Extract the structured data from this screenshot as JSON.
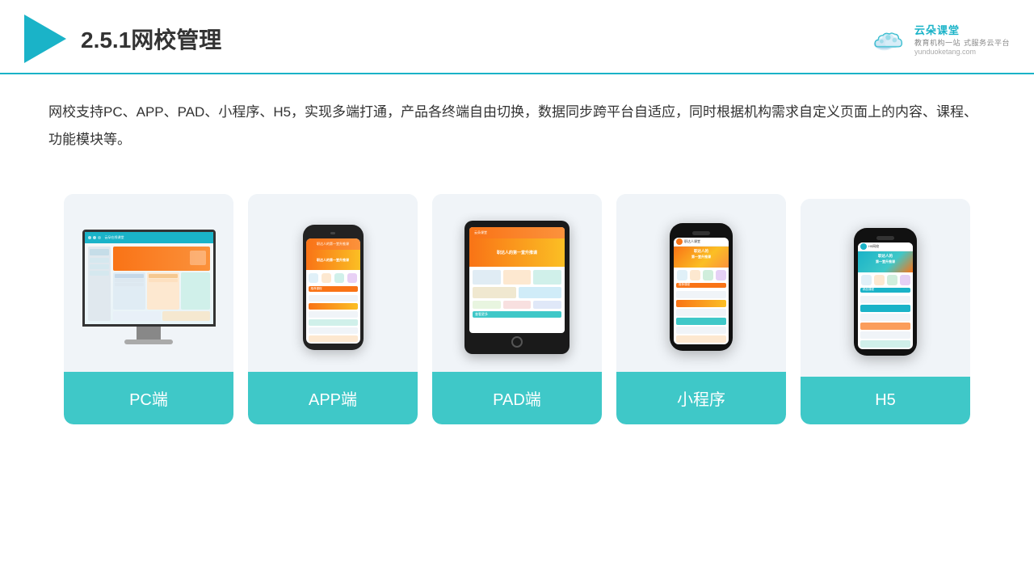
{
  "header": {
    "title": "网校管理",
    "title_prefix": "2.5.1",
    "brand_name": "云朵课堂",
    "brand_url": "yunduoketang.com",
    "brand_tagline": "教育机构一站",
    "brand_tagline2": "式服务云平台"
  },
  "description": {
    "text": "网校支持PC、APP、PAD、小程序、H5，实现多端打通，产品各终端自由切换，数据同步跨平台自适应，同时根据机构需求自定义页面上的内容、课程、功能模块等。"
  },
  "cards": [
    {
      "id": "pc",
      "label": "PC端"
    },
    {
      "id": "app",
      "label": "APP端"
    },
    {
      "id": "pad",
      "label": "PAD端"
    },
    {
      "id": "miniprogram",
      "label": "小程序"
    },
    {
      "id": "h5",
      "label": "H5"
    }
  ],
  "colors": {
    "accent": "#1ab3c8",
    "card_bg": "#f0f4f8",
    "card_label_bg": "#3fc8c8",
    "orange": "#f97316"
  }
}
